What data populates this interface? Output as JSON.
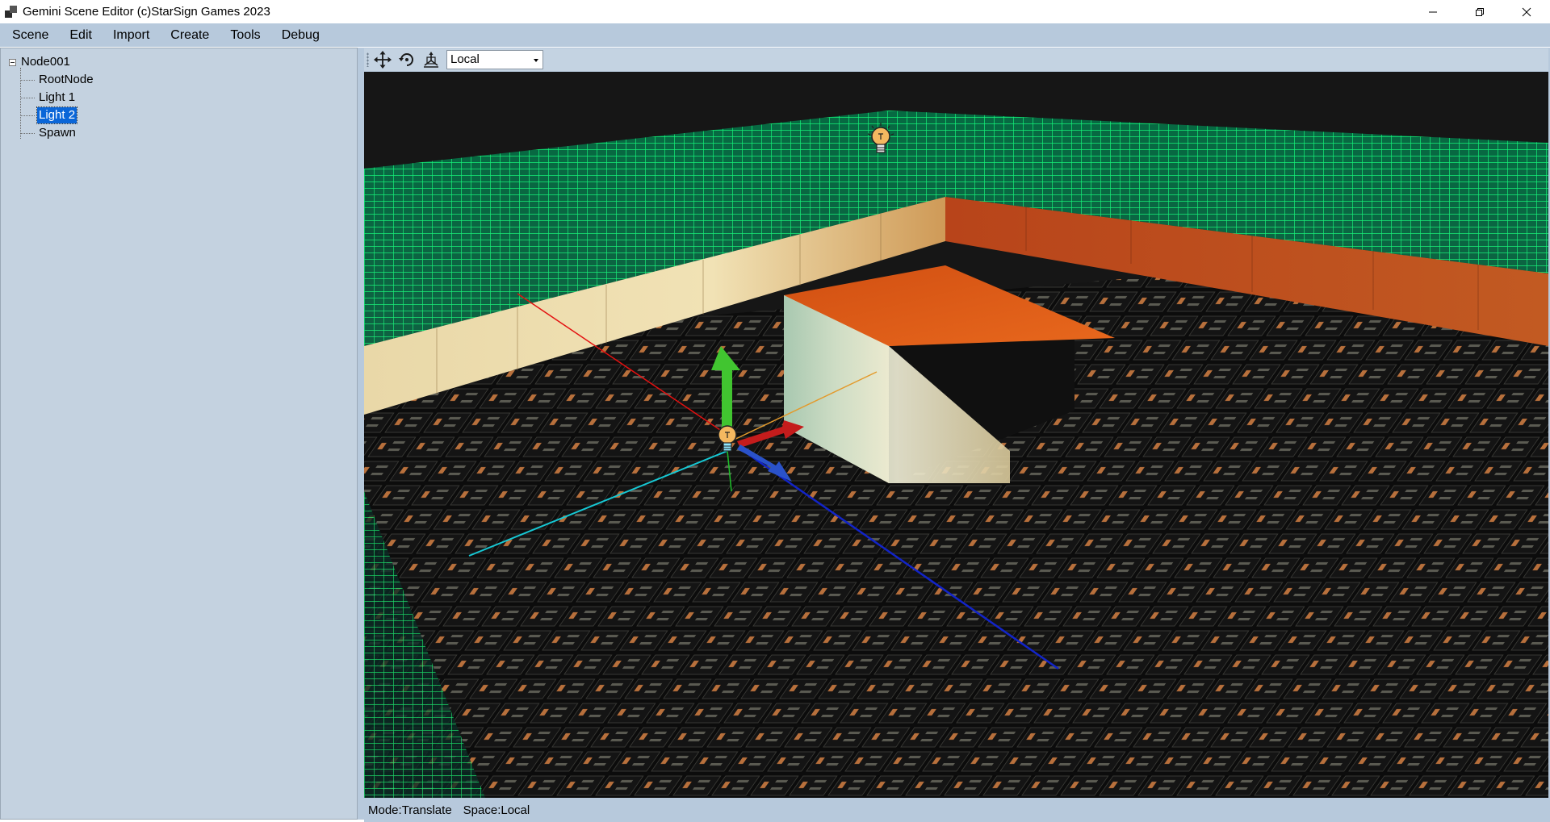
{
  "window": {
    "title": "Gemini Scene Editor (c)StarSign Games 2023"
  },
  "menu": {
    "items": [
      "Scene",
      "Edit",
      "Import",
      "Create",
      "Tools",
      "Debug"
    ]
  },
  "tree": {
    "root": "Node001",
    "children": [
      "RootNode",
      "Light 1",
      "Light 2",
      "Spawn"
    ],
    "selected": "Light 2"
  },
  "toolbar": {
    "tools": [
      "translate-tool-icon",
      "rotate-tool-icon",
      "scale-tool-icon"
    ],
    "space_value": "Local"
  },
  "status": {
    "mode": "Mode:Translate",
    "space": "Space:Local"
  },
  "colors": {
    "menubar": "#b7c9dc",
    "panel": "#c4d2e0",
    "selection": "#0a66d8",
    "gizmo_x": "#c41c1c",
    "gizmo_y": "#3fbf2a",
    "gizmo_z": "#2a52c9",
    "grid": "#00ff66"
  }
}
